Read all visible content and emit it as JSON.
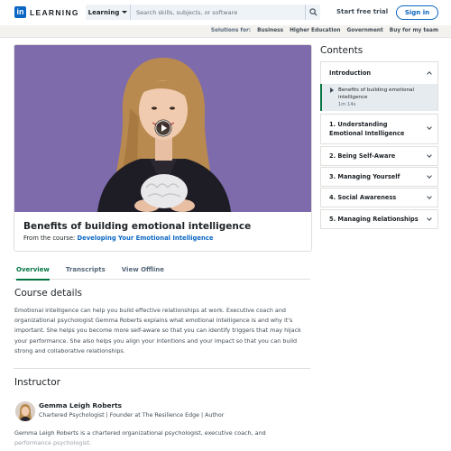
{
  "header": {
    "logo_letters": "in",
    "logo_text": "LEARNING",
    "search_type": "Learning",
    "search_placeholder": "Search skills, subjects, or software",
    "start_trial": "Start free trial",
    "sign_in": "Sign in"
  },
  "subnav": {
    "label": "Solutions for:",
    "items": [
      "Business",
      "Higher Education",
      "Government",
      "Buy for my team"
    ]
  },
  "video": {
    "title": "Benefits of building emotional intelligence",
    "from_label": "From the course:",
    "course_link": "Developing Your Emotional Intelligence"
  },
  "tabs": [
    "Overview",
    "Transcripts",
    "View Offline"
  ],
  "course_details": {
    "heading": "Course details",
    "text": "Emotional intelligence can help you build effective relationships at work. Executive coach and organizational psychologist Gemma Roberts explains what emotional intelligence is and why it's important. She helps you become more self-aware so that you can identify triggers that may hijack your performance. She also helps you align your intentions and your impact so that you can build strong and collaborative relationships."
  },
  "instructor": {
    "heading": "Instructor",
    "name": "Gemma Leigh Roberts",
    "title": "Chartered Psychologist | Founder at The Resilience Edge | Author",
    "bio_main": "Gemma Leigh Roberts is a chartered organizational psychologist, executive coach, and",
    "bio_faded": "performance psychologist."
  },
  "contents": {
    "heading": "Contents",
    "intro": {
      "label": "Introduction",
      "item_title": "Benefits of building emotional intelligence",
      "item_duration": "1m 14s"
    },
    "sections": [
      "1. Understanding Emotional Intelligence",
      "2. Being Self-Aware",
      "3. Managing Yourself",
      "4. Social Awareness",
      "5. Managing Relationships"
    ]
  },
  "colors": {
    "brand_blue": "#0a66c2",
    "active_green": "#057642",
    "video_bg": "#7a67a8"
  }
}
